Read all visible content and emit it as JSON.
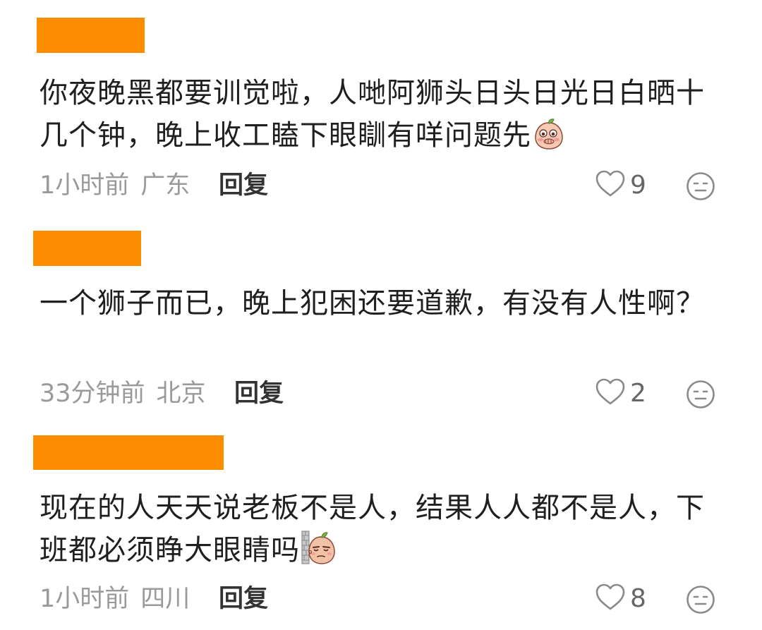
{
  "colors": {
    "redaction": "#fb8c00",
    "text": "#1f1f1f",
    "meta": "#9a9a9a",
    "icon": "#8a8a8a"
  },
  "comments": [
    {
      "text": "你夜晚黑都要训觉啦，人哋阿狮头日头日光日白晒十几个钟，晚上收工瞌下眼瞓有咩问题先",
      "emoji": "peach-covering-mouth-emoji",
      "time": "1小时前",
      "location": "广东",
      "reply_label": "回复",
      "likes": "9"
    },
    {
      "text": "一个狮子而已，晚上犯困还要道歉，有没有人性啊？",
      "time": "33分钟前",
      "location": "北京",
      "reply_label": "回复",
      "likes": "2"
    },
    {
      "text": "现在的人天天说老板不是人，结果人人都不是人，下班都必须睁大眼睛吗",
      "emoji": "peach-peeking-behind-wall-emoji",
      "time": "1小时前",
      "location": "四川",
      "reply_label": "回复",
      "likes": "8"
    }
  ]
}
